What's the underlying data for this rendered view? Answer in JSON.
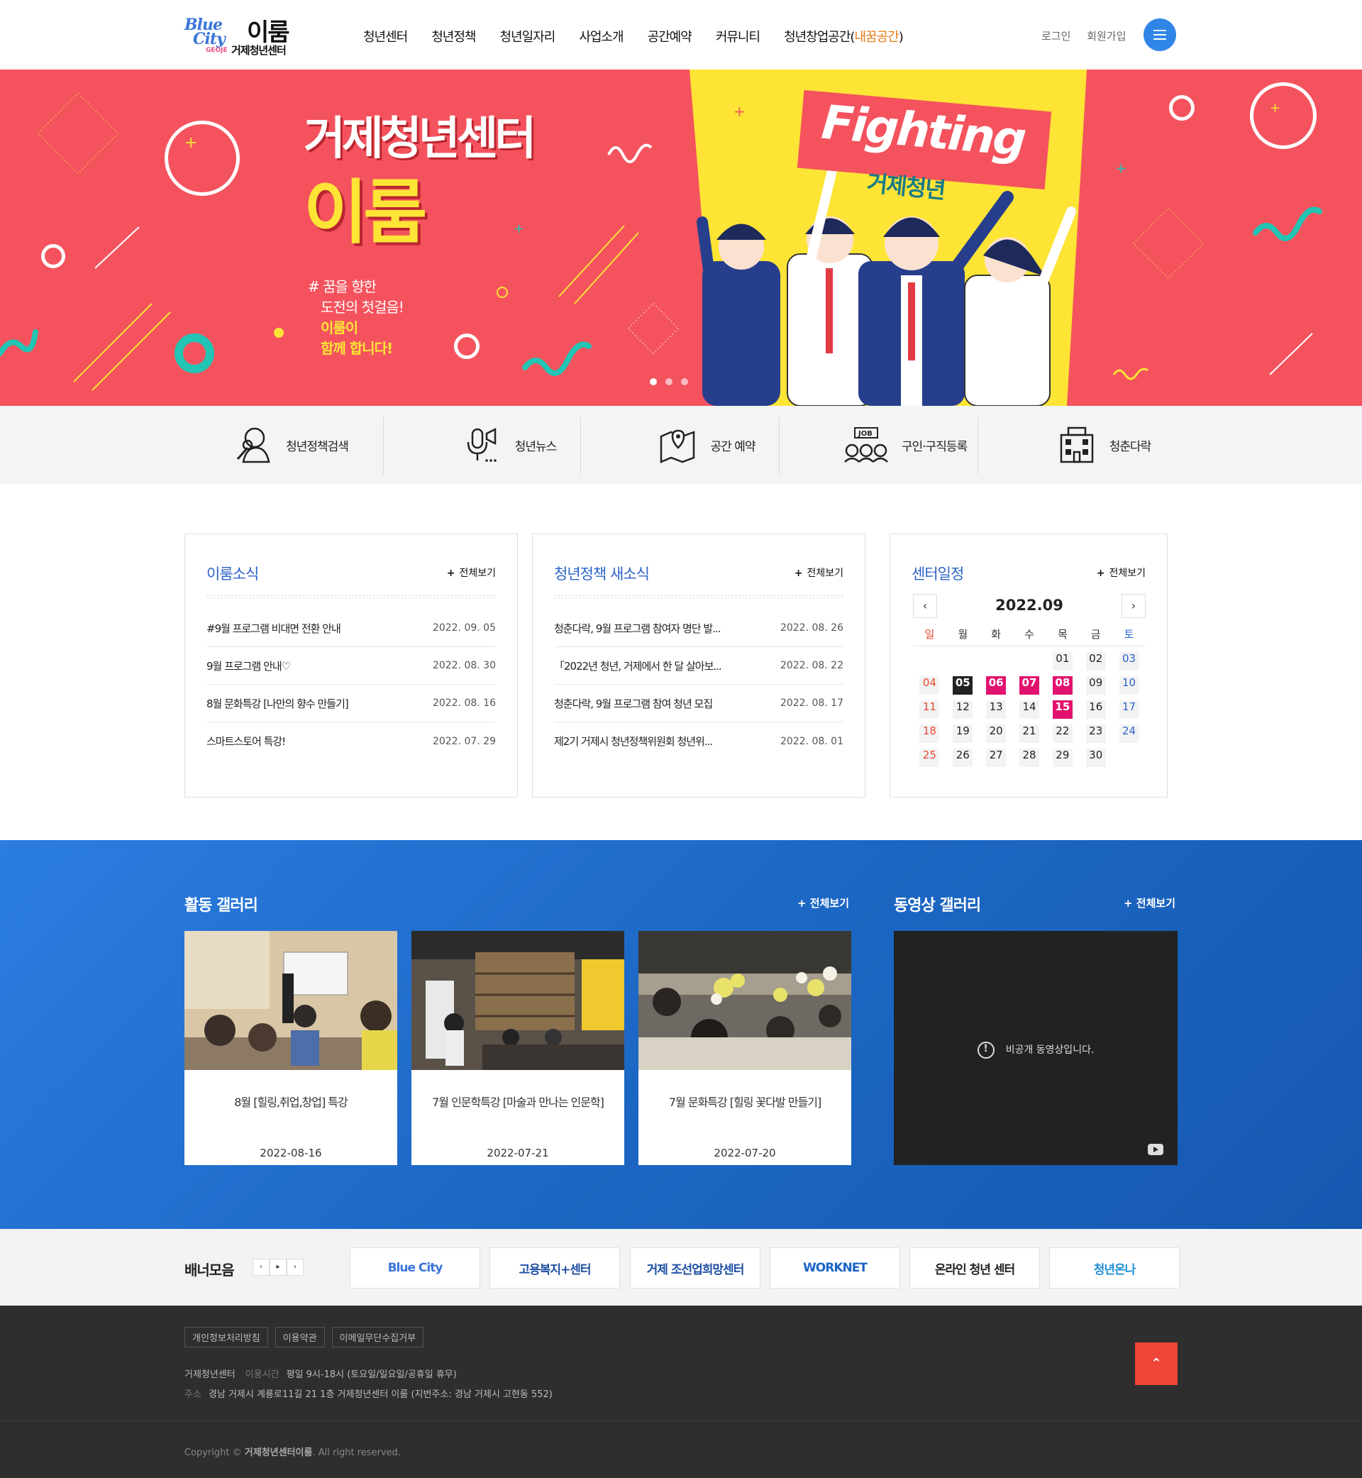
{
  "header": {
    "logo": {
      "blue": "Blue",
      "city": "City",
      "geoje": "GEOJE",
      "name": "이룸",
      "sub": "거제청년센터"
    },
    "nav": [
      "청년센터",
      "청년정책",
      "청년일자리",
      "사업소개",
      "공간예약",
      "커뮤니티"
    ],
    "nav_last": {
      "pre": "청년창업공간(",
      "hl": "내꿈공간",
      "post": ")"
    },
    "login": "로그인",
    "join": "회원가입"
  },
  "hero": {
    "title": "거제청년센터",
    "name": "이룸",
    "copy1": "# 꿈을 향한",
    "copy2": "도전의 첫걸음!",
    "copy3": "이룸이",
    "copy4": "함께 합니다!",
    "fighting": "Fighting",
    "fighting_sub": "거제청년",
    "slides": 3,
    "active_slide": 1
  },
  "quick": [
    {
      "label": "청년정책검색",
      "icon": "policy-search-icon"
    },
    {
      "label": "청년뉴스",
      "icon": "microphone-news-icon"
    },
    {
      "label": "공간 예약",
      "icon": "map-reservation-icon"
    },
    {
      "label": "구인·구직등록",
      "icon": "job-people-icon"
    },
    {
      "label": "청춘다락",
      "icon": "building-icon"
    }
  ],
  "news": {
    "title": "이룸소식",
    "more": "전체보기",
    "items": [
      {
        "title": "#9월 프로그램 비대면 전환 안내",
        "date": "2022. 09. 05"
      },
      {
        "title": "9월 프로그램 안내♡",
        "date": "2022. 08. 30"
      },
      {
        "title": "8월 문화특강 [나만의 향수 만들기]",
        "date": "2022. 08. 16"
      },
      {
        "title": "스마트스토어 특강!",
        "date": "2022. 07. 29"
      }
    ]
  },
  "policy": {
    "title": "청년정책 새소식",
    "more": "전체보기",
    "items": [
      {
        "title": "청춘다락, 9월 프로그램 참여자 명단 발...",
        "date": "2022. 08. 26"
      },
      {
        "title": "「2022년 청년, 거제에서 한 달 살아보...",
        "date": "2022. 08. 22"
      },
      {
        "title": "청춘다락, 9월 프로그램 참여 청년 모집",
        "date": "2022. 08. 17"
      },
      {
        "title": "제2기 거제시 청년정책위원회 청년위...",
        "date": "2022. 08. 01"
      }
    ]
  },
  "calendar": {
    "title": "센터일정",
    "more": "전체보기",
    "month": "2022.09",
    "prev": "‹",
    "next": "›",
    "weekdays": [
      "일",
      "월",
      "화",
      "수",
      "목",
      "금",
      "토"
    ],
    "first_weekday": 4,
    "days": 30,
    "today": 5,
    "events": [
      6,
      7,
      8,
      15
    ]
  },
  "gallery": {
    "title": "활동 갤러리",
    "more": "전체보기",
    "items": [
      {
        "caption": "8월 [힐링,취업,창업] 특강",
        "date": "2022-08-16"
      },
      {
        "caption": "7월 인문학특강 [마술과 만나는 인문학]",
        "date": "2022-07-21"
      },
      {
        "caption": "7월 문화특강 [힐링 꽃다발 만들기]",
        "date": "2022-07-20"
      }
    ]
  },
  "video": {
    "title": "동영상 갤러리",
    "more": "전체보기",
    "message": "비공개 동영상입니다."
  },
  "banners": {
    "title": "배너모음",
    "ctrl": [
      "‹",
      "▸",
      "›"
    ],
    "items": [
      {
        "label": "Blue City",
        "color": "#3a74d9"
      },
      {
        "label": "고용복지+센터",
        "color": "#1f4fa3"
      },
      {
        "label": "거제 조선업희망센터",
        "color": "#1f4fa3"
      },
      {
        "label": "WORKNET",
        "color": "#1b64c4"
      },
      {
        "label": "온라인 청년 센터",
        "color": "#222222"
      },
      {
        "label": "청년온나",
        "color": "#1f8fd6"
      }
    ]
  },
  "footer": {
    "links": [
      "개인정보처리방침",
      "이용약관",
      "이메일무단수집거부"
    ],
    "org": "거제청년센터",
    "hours_label": "이용시간",
    "hours": "평일 9시-18시 (토요일/일요일/공휴일 휴무)",
    "addr_label": "주소",
    "addr": "경남 거제시 계룡로11길 21 1층 거제청년센터 이룸 (지번주소: 경남 거제시 고현동 552)",
    "copy_pre": "Copyright © ",
    "copy_org": "거제청년센터이룸",
    "copy_post": ". All right reserved.",
    "top": "⌃"
  },
  "colors": {
    "hero_red": "#f4535e",
    "hero_yellow": "#fde435",
    "accent_blue": "#2b63c8",
    "event_pink": "#e2136f"
  }
}
